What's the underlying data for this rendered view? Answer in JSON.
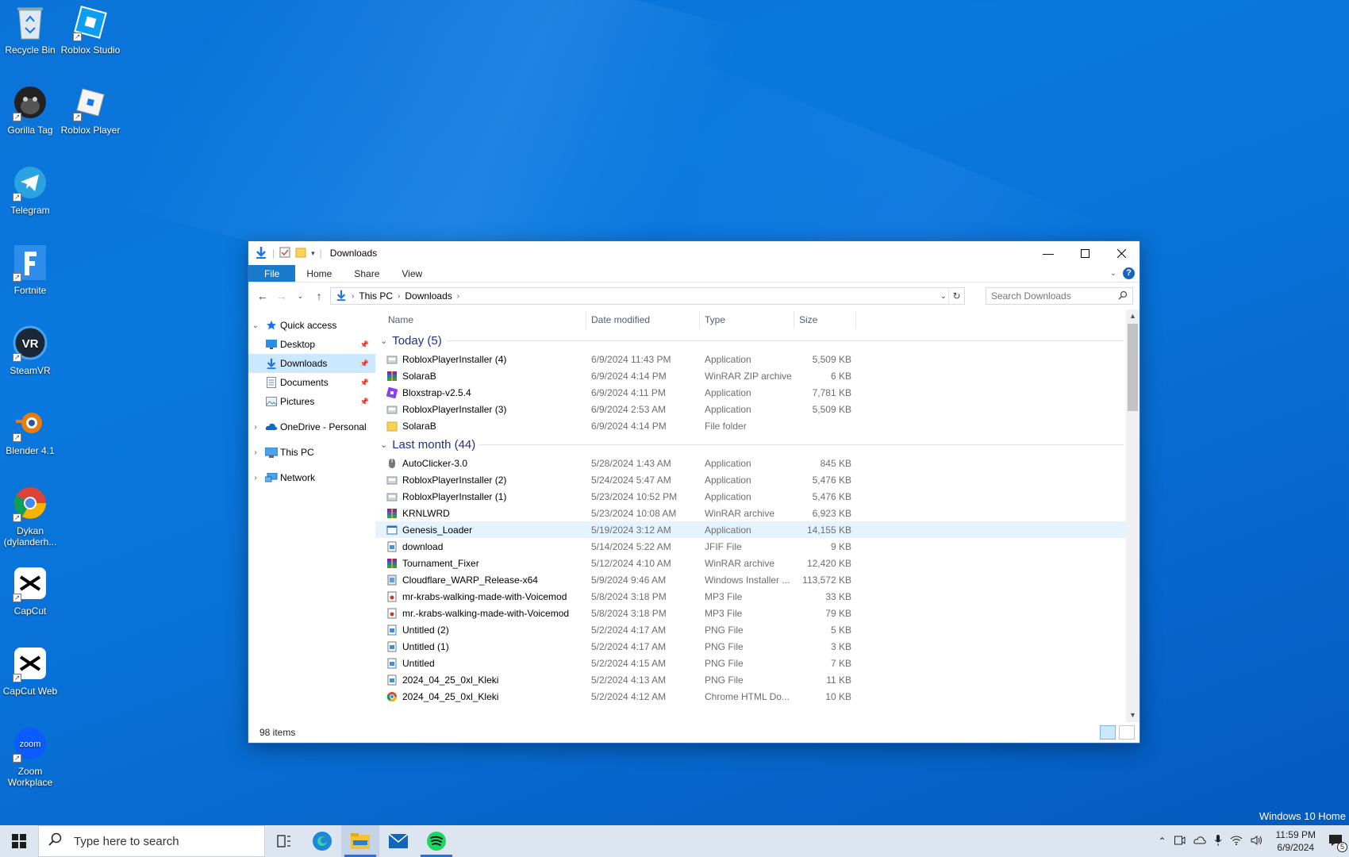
{
  "desktop": {
    "icons": [
      {
        "label": "Recycle Bin",
        "icon": "recycle-bin-icon"
      },
      {
        "label": "Roblox Studio",
        "icon": "roblox-studio-icon"
      },
      {
        "label": "Gorilla Tag",
        "icon": "gorilla-tag-icon"
      },
      {
        "label": "Roblox Player",
        "icon": "roblox-player-icon"
      },
      {
        "label": "Telegram",
        "icon": "telegram-icon"
      },
      {
        "label": "Fortnite",
        "icon": "fortnite-icon"
      },
      {
        "label": "SteamVR",
        "icon": "steamvr-icon"
      },
      {
        "label": "Blender 4.1",
        "icon": "blender-icon"
      },
      {
        "label": "Dykan (dylanderh...",
        "icon": "chrome-profile-icon"
      },
      {
        "label": "CapCut",
        "icon": "capcut-icon"
      },
      {
        "label": "CapCut Web",
        "icon": "capcut-web-icon"
      },
      {
        "label": "Zoom Workplace",
        "icon": "zoom-icon"
      }
    ],
    "watermark": "Windows 10 Home"
  },
  "explorer": {
    "title": "Downloads",
    "ribbon_tabs": [
      "File",
      "Home",
      "Share",
      "View"
    ],
    "breadcrumb": [
      "This PC",
      "Downloads"
    ],
    "search_placeholder": "Search Downloads",
    "nav": {
      "quick_access": "Quick access",
      "quick_items": [
        "Desktop",
        "Downloads",
        "Documents",
        "Pictures"
      ],
      "onedrive": "OneDrive - Personal",
      "this_pc": "This PC",
      "network": "Network"
    },
    "columns": {
      "name": "Name",
      "date": "Date modified",
      "type": "Type",
      "size": "Size"
    },
    "groups": [
      {
        "label": "Today (5)",
        "files": [
          {
            "name": "RobloxPlayerInstaller (4)",
            "date": "6/9/2024 11:43 PM",
            "type": "Application",
            "size": "5,509 KB",
            "icon": "installer-icon"
          },
          {
            "name": "SolaraB",
            "date": "6/9/2024 4:14 PM",
            "type": "WinRAR ZIP archive",
            "size": "6 KB",
            "icon": "winrar-icon"
          },
          {
            "name": "Bloxstrap-v2.5.4",
            "date": "6/9/2024 4:11 PM",
            "type": "Application",
            "size": "7,781 KB",
            "icon": "bloxstrap-icon"
          },
          {
            "name": "RobloxPlayerInstaller (3)",
            "date": "6/9/2024 2:53 AM",
            "type": "Application",
            "size": "5,509 KB",
            "icon": "installer-icon"
          },
          {
            "name": "SolaraB",
            "date": "6/9/2024 4:14 PM",
            "type": "File folder",
            "size": "",
            "icon": "folder-icon"
          }
        ]
      },
      {
        "label": "Last month (44)",
        "files": [
          {
            "name": "AutoClicker-3.0",
            "date": "5/28/2024 1:43 AM",
            "type": "Application",
            "size": "845 KB",
            "icon": "mouse-icon"
          },
          {
            "name": "RobloxPlayerInstaller (2)",
            "date": "5/24/2024 5:47 AM",
            "type": "Application",
            "size": "5,476 KB",
            "icon": "installer-icon"
          },
          {
            "name": "RobloxPlayerInstaller (1)",
            "date": "5/23/2024 10:52 PM",
            "type": "Application",
            "size": "5,476 KB",
            "icon": "installer-icon"
          },
          {
            "name": "KRNLWRD",
            "date": "5/23/2024 10:08 AM",
            "type": "WinRAR archive",
            "size": "6,923 KB",
            "icon": "winrar-icon"
          },
          {
            "name": "Genesis_Loader",
            "date": "5/19/2024 3:12 AM",
            "type": "Application",
            "size": "14,155 KB",
            "icon": "app-window-icon"
          },
          {
            "name": "download",
            "date": "5/14/2024 5:22 AM",
            "type": "JFIF File",
            "size": "9 KB",
            "icon": "image-file-icon"
          },
          {
            "name": "Tournament_Fixer",
            "date": "5/12/2024 4:10 AM",
            "type": "WinRAR archive",
            "size": "12,420 KB",
            "icon": "winrar-icon"
          },
          {
            "name": "Cloudflare_WARP_Release-x64",
            "date": "5/9/2024 9:46 AM",
            "type": "Windows Installer ...",
            "size": "113,572 KB",
            "icon": "msi-icon"
          },
          {
            "name": "mr-krabs-walking-made-with-Voicemod",
            "date": "5/8/2024 3:18 PM",
            "type": "MP3 File",
            "size": "33 KB",
            "icon": "audio-file-icon"
          },
          {
            "name": "mr.-krabs-walking-made-with-Voicemod",
            "date": "5/8/2024 3:18 PM",
            "type": "MP3 File",
            "size": "79 KB",
            "icon": "audio-file-icon"
          },
          {
            "name": "Untitled (2)",
            "date": "5/2/2024 4:17 AM",
            "type": "PNG File",
            "size": "5 KB",
            "icon": "image-file-icon"
          },
          {
            "name": "Untitled (1)",
            "date": "5/2/2024 4:17 AM",
            "type": "PNG File",
            "size": "3 KB",
            "icon": "image-file-icon"
          },
          {
            "name": "Untitled",
            "date": "5/2/2024 4:15 AM",
            "type": "PNG File",
            "size": "7 KB",
            "icon": "image-file-icon"
          },
          {
            "name": "2024_04_25_0xl_Kleki",
            "date": "5/2/2024 4:13 AM",
            "type": "PNG File",
            "size": "11 KB",
            "icon": "image-file-icon"
          },
          {
            "name": "2024_04_25_0xl_Kleki",
            "date": "5/2/2024 4:12 AM",
            "type": "Chrome HTML Do...",
            "size": "10 KB",
            "icon": "chrome-icon"
          }
        ]
      }
    ],
    "status": "98 items"
  },
  "taskbar": {
    "search_placeholder": "Type here to search",
    "apps": [
      "task-view-icon",
      "edge-icon",
      "file-explorer-icon",
      "mail-icon",
      "spotify-icon"
    ],
    "time": "11:59 PM",
    "date": "6/9/2024",
    "notification_count": "5"
  }
}
